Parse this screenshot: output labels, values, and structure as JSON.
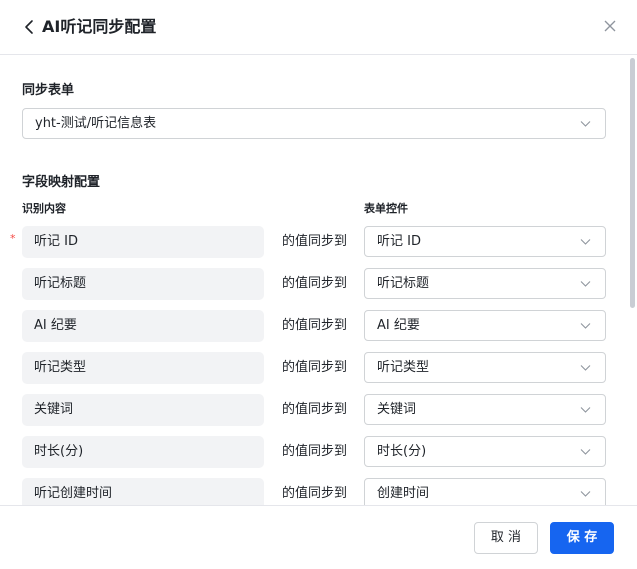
{
  "header": {
    "title": "AI听记同步配置",
    "back_icon": "chevron-left-icon",
    "close_icon": "close-icon"
  },
  "sync_form": {
    "label": "同步表单",
    "selected": "yht-测试/听记信息表"
  },
  "field_mapping": {
    "label": "字段映射配置",
    "column_source": "识别内容",
    "column_target": "表单控件",
    "sync_text": "的值同步到",
    "required_mark": "*",
    "rows": [
      {
        "source": "听记 ID",
        "target": "听记 ID",
        "required": true
      },
      {
        "source": "听记标题",
        "target": "听记标题",
        "required": false
      },
      {
        "source": "AI 纪要",
        "target": "AI 纪要",
        "required": false
      },
      {
        "source": "听记类型",
        "target": "听记类型",
        "required": false
      },
      {
        "source": "关键词",
        "target": "关键词",
        "required": false
      },
      {
        "source": "时长(分)",
        "target": "时长(分)",
        "required": false
      },
      {
        "source": "听记创建时间",
        "target": "创建时间",
        "required": false
      }
    ]
  },
  "footer": {
    "cancel_label": "取 消",
    "save_label": "保 存"
  },
  "colors": {
    "primary": "#1665f0",
    "required": "#f54a45",
    "field_bg": "#f2f3f5",
    "border": "#d0d3d6"
  }
}
